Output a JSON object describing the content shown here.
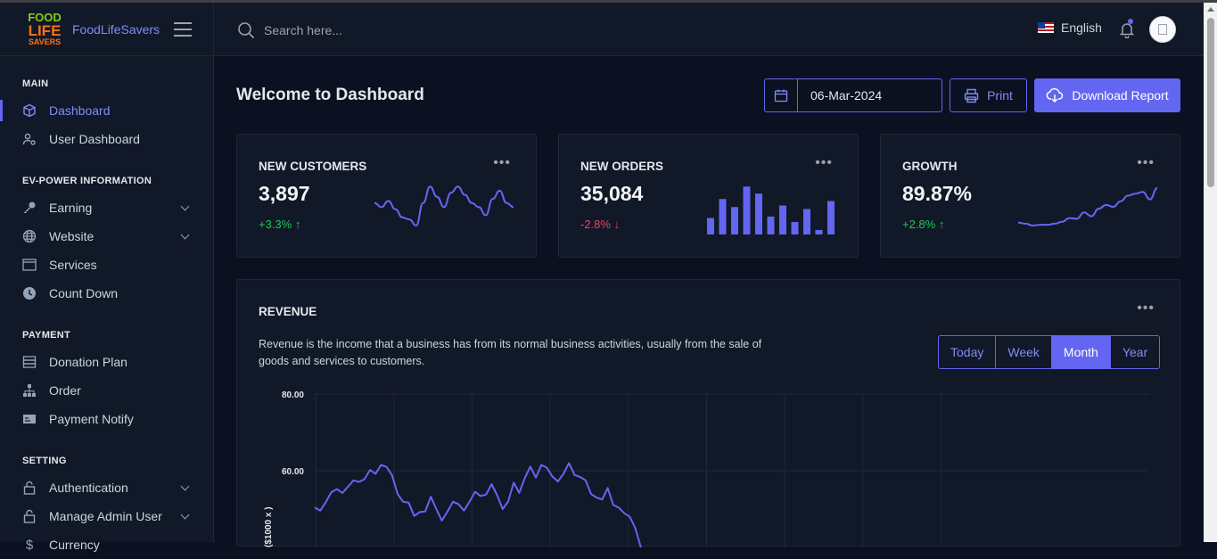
{
  "brand": {
    "logo_line1": "FOOD",
    "logo_line2": "LIFE",
    "logo_line3": "SAVERS",
    "name": "FoodLifeSavers"
  },
  "sidebar": {
    "sections": [
      {
        "title": "MAIN",
        "items": [
          {
            "label": "Dashboard",
            "icon": "cube-icon",
            "active": true
          },
          {
            "label": "User Dashboard",
            "icon": "user-gear-icon"
          }
        ]
      },
      {
        "title": "EV-POWER INFORMATION",
        "items": [
          {
            "label": "Earning",
            "icon": "key-icon",
            "expandable": true
          },
          {
            "label": "Website",
            "icon": "globe-icon",
            "expandable": true
          },
          {
            "label": "Services",
            "icon": "window-icon"
          },
          {
            "label": "Count Down",
            "icon": "clock-icon"
          }
        ]
      },
      {
        "title": "PAYMENT",
        "items": [
          {
            "label": "Donation Plan",
            "icon": "server-icon"
          },
          {
            "label": "Order",
            "icon": "sitemap-icon"
          },
          {
            "label": "Payment Notify",
            "icon": "card-icon"
          }
        ]
      },
      {
        "title": "SETTING",
        "items": [
          {
            "label": "Authentication",
            "icon": "lock-icon",
            "expandable": true
          },
          {
            "label": "Manage Admin User",
            "icon": "lock-icon",
            "expandable": true
          },
          {
            "label": "Currency",
            "icon": "dollar-icon"
          }
        ]
      }
    ]
  },
  "header": {
    "search_placeholder": "Search here...",
    "language": "English"
  },
  "main": {
    "title": "Welcome to Dashboard",
    "date": "06-Mar-2024",
    "print_label": "Print",
    "download_label": "Download Report"
  },
  "cards": [
    {
      "title": "NEW CUSTOMERS",
      "value": "3,897",
      "change": "+3.3%",
      "direction": "up"
    },
    {
      "title": "NEW ORDERS",
      "value": "35,084",
      "change": "-2.8%",
      "direction": "down"
    },
    {
      "title": "GROWTH",
      "value": "89.87%",
      "change": "+2.8%",
      "direction": "up"
    }
  ],
  "revenue": {
    "title": "REVENUE",
    "description": "Revenue is the income that a business has from its normal business activities, usually from the sale of goods and services to customers.",
    "periods": [
      "Today",
      "Week",
      "Month",
      "Year"
    ],
    "selected_period": "Month"
  },
  "colors": {
    "accent": "#6366f1",
    "up": "#22c55e",
    "down": "#f43f5e",
    "background": "#0b1120",
    "panel": "#111827"
  },
  "chart_data": {
    "type": "line",
    "ylabel": "($1000 x )",
    "y_tick_labels": [
      "80.00",
      "60.00"
    ],
    "ylim": [
      0,
      80
    ],
    "series": [
      {
        "values": [
          50.4,
          49.6,
          51.8,
          54.4,
          55.2,
          54.2,
          55.8,
          57.5,
          57.1,
          57.8,
          60.2,
          59.2,
          61.5,
          61.0,
          58.8,
          53.9,
          51.9,
          51.7,
          48.2,
          49.2,
          49.4,
          53.2,
          50.0,
          47.0,
          49.3,
          51.9,
          51.3,
          49.6,
          51.9,
          54.5,
          53.4,
          53.8,
          56.5,
          53.6,
          50.0,
          52.0,
          56.9,
          54.2,
          58.1,
          61.1,
          58.2,
          61.5,
          60.8,
          58.5,
          57.2,
          59.2,
          62.0,
          58.9,
          58.4,
          57.5,
          53.9,
          53.0,
          52.5,
          55.5,
          51.1,
          50.4,
          48.9,
          48.0,
          45.0,
          40.0
        ]
      }
    ],
    "grid": true
  },
  "sparklines": {
    "customers": [
      0.55,
      0.45,
      0.6,
      0.4,
      0.2,
      0.15,
      0.0,
      0.55,
      0.95,
      0.7,
      0.45,
      0.8,
      0.95,
      0.75,
      0.55,
      0.45,
      0.25,
      0.65,
      0.85,
      0.55,
      0.45
    ],
    "orders": [
      0.33,
      0.71,
      0.55,
      0.96,
      0.82,
      0.36,
      0.58,
      0.25,
      0.51,
      0.09,
      0.67
    ],
    "growth": [
      0.08,
      0.05,
      0.0,
      0.02,
      0.02,
      0.05,
      0.1,
      0.2,
      0.18,
      0.35,
      0.25,
      0.45,
      0.55,
      0.5,
      0.65,
      0.8,
      0.85,
      0.9,
      0.7,
      1.0
    ]
  }
}
